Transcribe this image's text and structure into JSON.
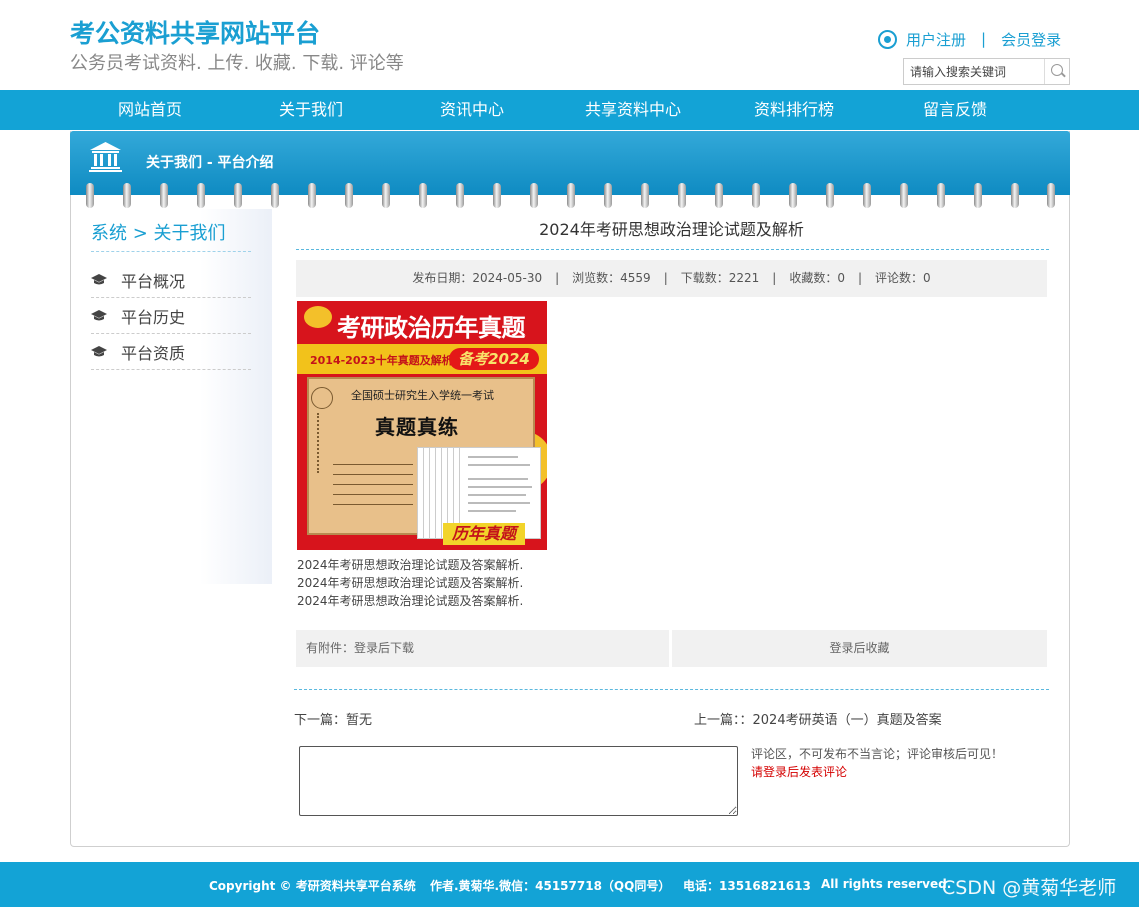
{
  "header": {
    "site_title": "考公资料共享网站平台",
    "site_subtitle": "公务员考试资料. 上传. 收藏. 下载. 评论等",
    "register_label": "用户注册",
    "separator": "|",
    "login_label": "会员登录",
    "search_placeholder": "请输入搜索关键词",
    "accent_color": "#1a9fd2"
  },
  "nav": {
    "items": [
      "网站首页",
      "关于我们",
      "资讯中心",
      "共享资料中心",
      "资料排行榜",
      "留言反馈"
    ],
    "background_color": "#13a3d6"
  },
  "banner": {
    "breadcrumb": "关于我们 - 平台介绍",
    "icon": "bank-icon"
  },
  "sidebar": {
    "title": "系统 > 关于我们",
    "items": [
      "平台概况",
      "平台历史",
      "平台资质"
    ],
    "item_icon": "graduation-cap-icon"
  },
  "article": {
    "title": "2024年考研思想政治理论试题及解析",
    "meta": {
      "publish_date": "发布日期：2024-05-30",
      "views": "浏览数：4559",
      "downloads": "下载数：2221",
      "favorites": "收藏数：0",
      "comments": "评论数：0",
      "separator": "|"
    },
    "cover": {
      "headline": "考研政治历年真题",
      "subline": "2014-2023十年真题及解析",
      "badge": "备考2024",
      "exam_line": "全国硕士研究生入学统一考试",
      "big_text": "真题真练",
      "tag": "历年真题"
    },
    "description_lines": [
      "2024年考研思想政治理论试题及答案解析.",
      "2024年考研思想政治理论试题及答案解析.",
      "2024年考研思想政治理论试题及答案解析."
    ],
    "attachment": "有附件：登录后下载",
    "favorite": "登录后收藏",
    "next": "下一篇：暂无",
    "prev": "上一篇：：2024考研英语（一）真题及答案"
  },
  "comment": {
    "note": "评论区，不可发布不当言论；评论审核后可见！",
    "login_prompt": "请登录后发表评论",
    "prompt_color": "#d40000"
  },
  "footer": {
    "copyright": "Copyright © 考研资料共享平台系统",
    "author": "作者.黄菊华.微信：45157718（QQ同号）",
    "phone": "电话：13516821613",
    "rights": "All rights reserved.",
    "watermark": "CSDN @黄菊华老师"
  }
}
